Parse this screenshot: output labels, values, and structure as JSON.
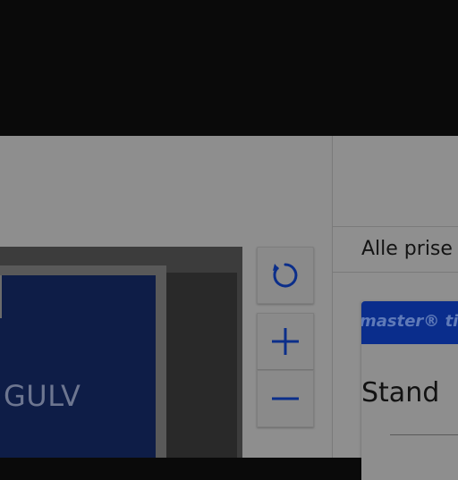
{
  "map": {
    "floor_label": "GULV",
    "controls": {
      "reset_icon": "rotate-icon",
      "zoom_in_icon": "plus-icon",
      "zoom_out_icon": "minus-icon"
    }
  },
  "panel": {
    "filter_label": "Alle prise",
    "ticket": {
      "banner_text": "master®  tic",
      "type_label": "Stand"
    }
  },
  "colors": {
    "accent": "#0a2d8c",
    "floor": "#0e1d47"
  }
}
